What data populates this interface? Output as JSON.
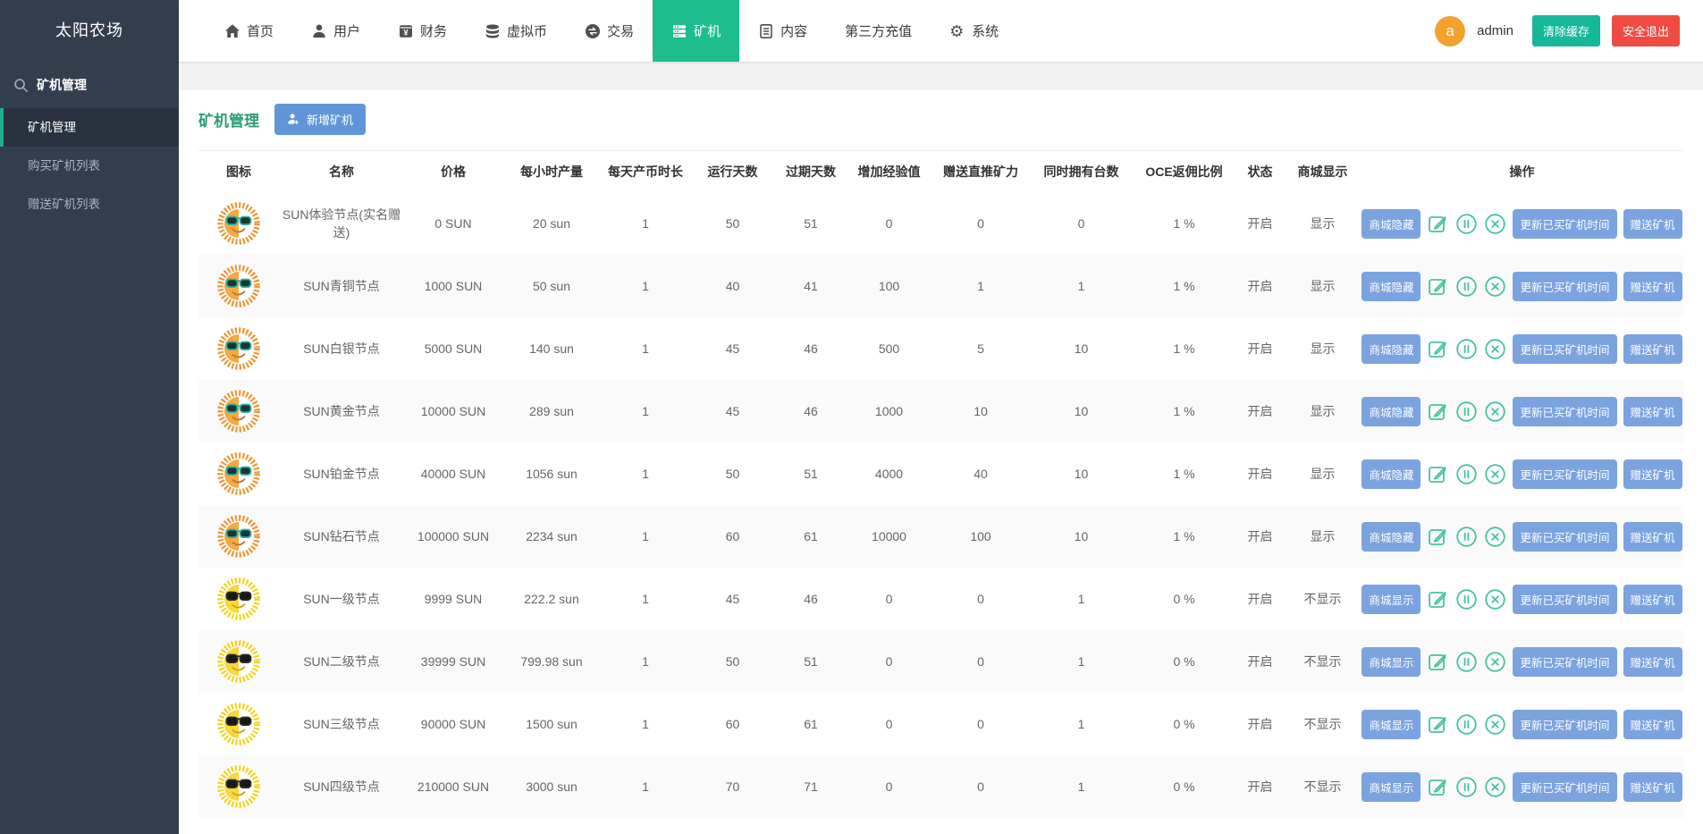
{
  "app": {
    "title": "太阳农场"
  },
  "sidebar": {
    "group_label": "矿机管理",
    "group_icon": "search-icon",
    "items": [
      {
        "label": "矿机管理",
        "active": true
      },
      {
        "label": "购买矿机列表",
        "active": false
      },
      {
        "label": "赠送矿机列表",
        "active": false
      }
    ]
  },
  "navbar": {
    "items": [
      {
        "label": "首页",
        "icon": "home-icon",
        "active": false
      },
      {
        "label": "用户",
        "icon": "user-icon",
        "active": false
      },
      {
        "label": "财务",
        "icon": "finance-icon",
        "active": false
      },
      {
        "label": "虚拟币",
        "icon": "coins-icon",
        "active": false
      },
      {
        "label": "交易",
        "icon": "exchange-icon",
        "active": false
      },
      {
        "label": "矿机",
        "icon": "miner-icon",
        "active": true
      },
      {
        "label": "内容",
        "icon": "content-icon",
        "active": false
      },
      {
        "label": "第三方充值",
        "icon": null,
        "active": false
      },
      {
        "label": "系统",
        "icon": "gear-icon",
        "active": false
      }
    ],
    "user": {
      "avatar_letter": "a",
      "name": "admin"
    },
    "clear_cache_label": "清除缓存",
    "logout_label": "安全退出"
  },
  "page": {
    "title": "矿机管理",
    "add_button_label": "新增矿机"
  },
  "table": {
    "headers": [
      "图标",
      "名称",
      "价格",
      "每小时产量",
      "每天产币时长",
      "运行天数",
      "过期天数",
      "增加经验值",
      "赠送直推矿力",
      "同时拥有台数",
      "OCE返佣比例",
      "状态",
      "商城显示",
      "操作"
    ],
    "action_labels": {
      "update": "更新已买矿机时间",
      "gift": "赠送矿机"
    },
    "rows": [
      {
        "icon": "orange-sun-icon",
        "name": "SUN体验节点(实名赠送)",
        "price": "0 SUN",
        "hourly": "20 sun",
        "hours": "1",
        "run_days": "50",
        "expire_days": "51",
        "exp": "0",
        "gift_power": "0",
        "max_own": "0",
        "oce": "1 %",
        "status": "开启",
        "mall": "显示",
        "mall_btn": "商城隐藏"
      },
      {
        "icon": "orange-sun-icon",
        "name": "SUN青铜节点",
        "price": "1000 SUN",
        "hourly": "50 sun",
        "hours": "1",
        "run_days": "40",
        "expire_days": "41",
        "exp": "100",
        "gift_power": "1",
        "max_own": "1",
        "oce": "1 %",
        "status": "开启",
        "mall": "显示",
        "mall_btn": "商城隐藏"
      },
      {
        "icon": "orange-sun-icon",
        "name": "SUN白银节点",
        "price": "5000 SUN",
        "hourly": "140 sun",
        "hours": "1",
        "run_days": "45",
        "expire_days": "46",
        "exp": "500",
        "gift_power": "5",
        "max_own": "10",
        "oce": "1 %",
        "status": "开启",
        "mall": "显示",
        "mall_btn": "商城隐藏"
      },
      {
        "icon": "orange-sun-icon",
        "name": "SUN黄金节点",
        "price": "10000 SUN",
        "hourly": "289 sun",
        "hours": "1",
        "run_days": "45",
        "expire_days": "46",
        "exp": "1000",
        "gift_power": "10",
        "max_own": "10",
        "oce": "1 %",
        "status": "开启",
        "mall": "显示",
        "mall_btn": "商城隐藏"
      },
      {
        "icon": "orange-sun-icon",
        "name": "SUN铂金节点",
        "price": "40000 SUN",
        "hourly": "1056 sun",
        "hours": "1",
        "run_days": "50",
        "expire_days": "51",
        "exp": "4000",
        "gift_power": "40",
        "max_own": "10",
        "oce": "1 %",
        "status": "开启",
        "mall": "显示",
        "mall_btn": "商城隐藏"
      },
      {
        "icon": "orange-sun-icon",
        "name": "SUN钻石节点",
        "price": "100000 SUN",
        "hourly": "2234 sun",
        "hours": "1",
        "run_days": "60",
        "expire_days": "61",
        "exp": "10000",
        "gift_power": "100",
        "max_own": "10",
        "oce": "1 %",
        "status": "开启",
        "mall": "显示",
        "mall_btn": "商城隐藏"
      },
      {
        "icon": "yellow-sun-icon",
        "name": "SUN一级节点",
        "price": "9999 SUN",
        "hourly": "222.2 sun",
        "hours": "1",
        "run_days": "45",
        "expire_days": "46",
        "exp": "0",
        "gift_power": "0",
        "max_own": "1",
        "oce": "0 %",
        "status": "开启",
        "mall": "不显示",
        "mall_btn": "商城显示"
      },
      {
        "icon": "yellow-sun-icon",
        "name": "SUN二级节点",
        "price": "39999 SUN",
        "hourly": "799.98 sun",
        "hours": "1",
        "run_days": "50",
        "expire_days": "51",
        "exp": "0",
        "gift_power": "0",
        "max_own": "1",
        "oce": "0 %",
        "status": "开启",
        "mall": "不显示",
        "mall_btn": "商城显示"
      },
      {
        "icon": "yellow-sun-icon",
        "name": "SUN三级节点",
        "price": "90000 SUN",
        "hourly": "1500 sun",
        "hours": "1",
        "run_days": "60",
        "expire_days": "61",
        "exp": "0",
        "gift_power": "0",
        "max_own": "1",
        "oce": "0 %",
        "status": "开启",
        "mall": "不显示",
        "mall_btn": "商城显示"
      },
      {
        "icon": "yellow-sun-icon",
        "name": "SUN四级节点",
        "price": "210000 SUN",
        "hourly": "3000 sun",
        "hours": "1",
        "run_days": "70",
        "expire_days": "71",
        "exp": "0",
        "gift_power": "0",
        "max_own": "1",
        "oce": "0 %",
        "status": "开启",
        "mall": "不显示",
        "mall_btn": "商城显示"
      }
    ]
  },
  "colors": {
    "sidebar_bg": "#333e4d",
    "sidebar_active_bg": "#29323e",
    "sidebar_active_border": "#1caf89",
    "nav_active_green": "#1ebd8e",
    "page_title_green": "#2b9d75",
    "add_button_blue": "#6096d9",
    "row_button_blue": "#7aa3e0",
    "icon_button_green": "#47c494",
    "clear_cache_teal": "#17b79a",
    "logout_red": "#f04b43",
    "avatar_orange": "#f5a12d"
  }
}
